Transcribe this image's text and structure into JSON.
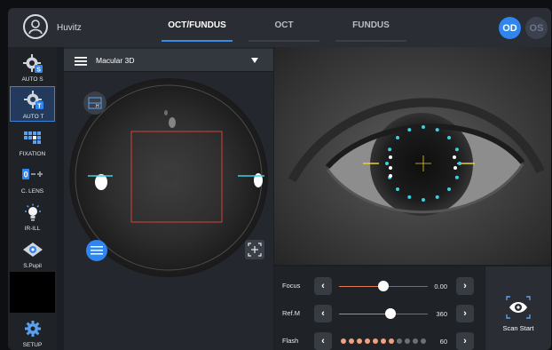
{
  "header": {
    "username": "Huvitz",
    "tabs": [
      {
        "label": "OCT/FUNDUS",
        "active": true
      },
      {
        "label": "OCT",
        "active": false
      },
      {
        "label": "FUNDUS",
        "active": false
      }
    ],
    "eye_selector": {
      "od_label": "OD",
      "os_label": "OS",
      "selected": "OD"
    }
  },
  "sidebar": {
    "items": [
      {
        "label": "AUTO S",
        "icon": "auto-s-icon",
        "active": false
      },
      {
        "label": "AUTO T",
        "icon": "auto-t-icon",
        "active": true
      },
      {
        "label": "FIXATION",
        "icon": "fixation-grid-icon",
        "active": false
      },
      {
        "label": "C. LENS",
        "icon": "contact-lens-icon",
        "active": false
      },
      {
        "label": "IR-ILL",
        "icon": "ir-illumination-icon",
        "active": false
      },
      {
        "label": "S.Pupil",
        "icon": "small-pupil-icon",
        "active": false
      },
      {
        "label": "SETUP",
        "icon": "gear-icon",
        "active": false
      }
    ]
  },
  "scan_panel": {
    "protocol": "Macular 3D",
    "menu_icon": "hamburger-menu-icon"
  },
  "controls": {
    "focus": {
      "label": "Focus",
      "value": "0.00",
      "position": 0.5
    },
    "refm": {
      "label": "Ref.M",
      "value": "360",
      "position": 0.58
    },
    "flash": {
      "label": "Flash",
      "value": "60",
      "level": 7,
      "max": 11
    }
  },
  "scan_start": {
    "label": "Scan Start",
    "icon": "eye-scan-icon"
  },
  "colors": {
    "accent": "#2f86f0",
    "flash_on": "#f0a080",
    "flash_off": "#6b6f78",
    "scan_box": "#d04040",
    "fixation_dots": "#3ad0e0",
    "crosshair": "#e8d030"
  }
}
